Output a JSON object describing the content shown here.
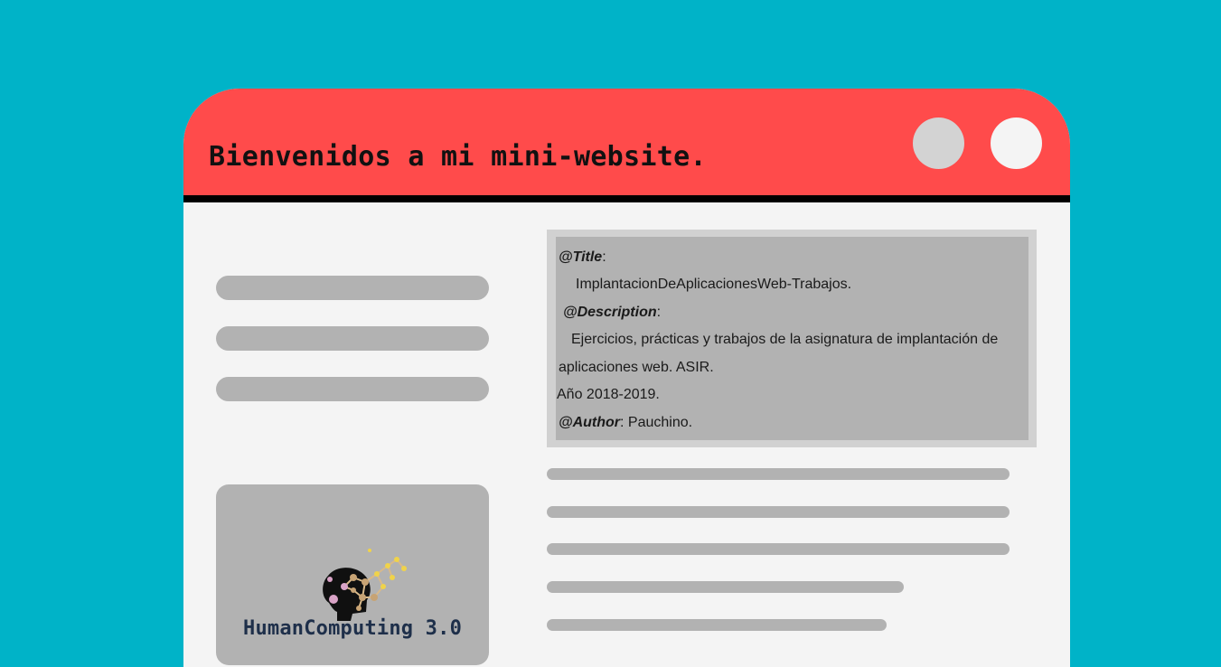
{
  "header": {
    "title": "Bienvenidos a mi mini-website."
  },
  "info": {
    "title_label": "@Title",
    "title_value": "ImplantacionDeAplicacionesWeb-Trabajos.",
    "description_label": "@Description",
    "description_line1": "Ejercicios, prácticas y trabajos de la asignatura de implantación de",
    "description_line2": "aplicaciones web. ASIR.",
    "year": "Año 2018-2019.",
    "author_label": "@Author",
    "author_value": "Pauchino."
  },
  "logo": {
    "text": "HumanComputing 3.0"
  },
  "colors": {
    "background": "#00b3c8",
    "titlebar": "#ff4b4b",
    "window": "#f4f4f4",
    "placeholder": "#b2b2b2"
  }
}
